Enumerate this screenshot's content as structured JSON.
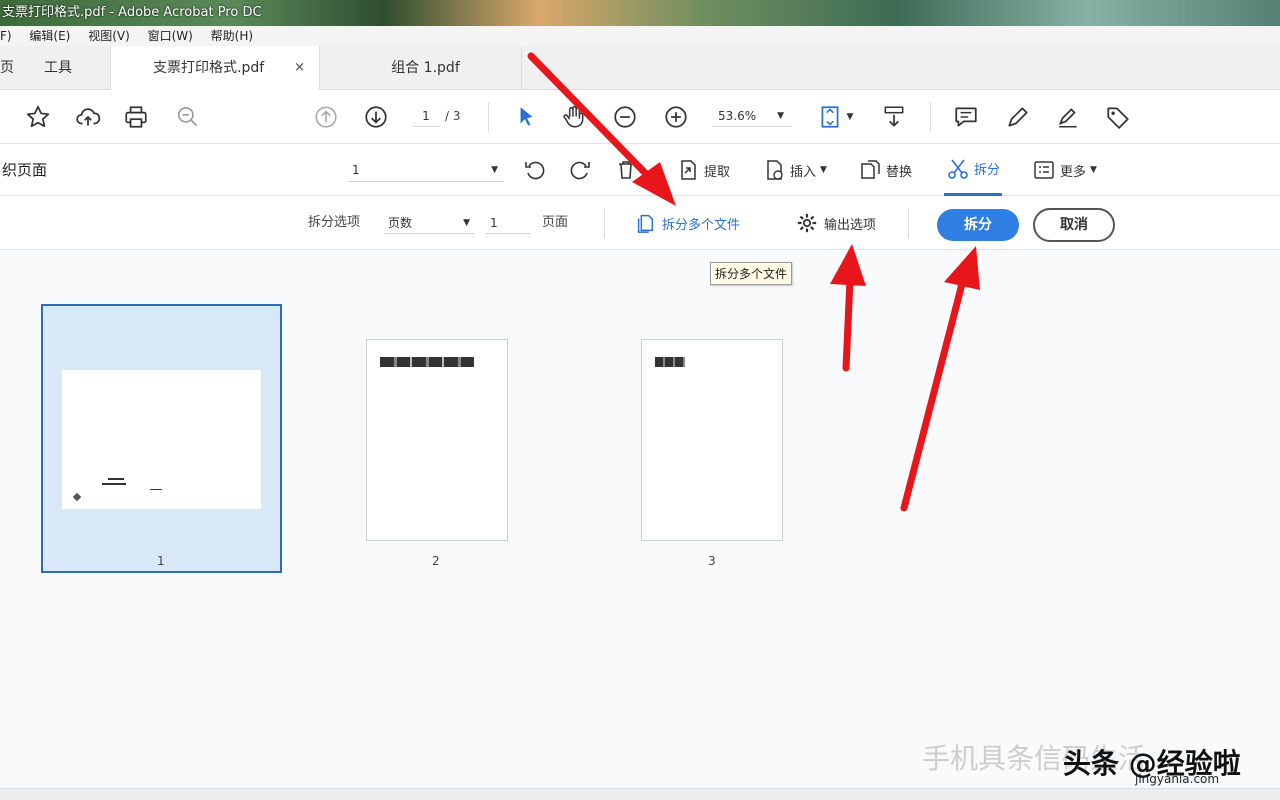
{
  "window": {
    "title": "支票打印格式.pdf - Adobe Acrobat Pro DC"
  },
  "menu": [
    "F)",
    "编辑(E)",
    "视图(V)",
    "窗口(W)",
    "帮助(H)"
  ],
  "tabs": {
    "home": "页",
    "tools": "工具",
    "doc": "支票打印格式.pdf",
    "close": "×",
    "doc2": "组合 1.pdf"
  },
  "toolbar": {
    "page_current": "1",
    "page_total": "/ 3",
    "zoom": "53.6%"
  },
  "organize": {
    "title": "织页面",
    "page_select": "1",
    "items": {
      "extract": "提取",
      "insert": "插入",
      "replace": "替换",
      "split": "拆分",
      "more": "更多"
    }
  },
  "split": {
    "options_label": "拆分选项",
    "mode": "页数",
    "count": "1",
    "unit": "页面",
    "multi_files": "拆分多个文件",
    "output_options": "输出选项",
    "split_button": "拆分",
    "cancel_button": "取消",
    "tooltip": "拆分多个文件"
  },
  "pages": [
    {
      "number": "1"
    },
    {
      "number": "2"
    },
    {
      "number": "3"
    }
  ],
  "watermark": {
    "line1": "手机具条信码生活",
    "line2": "头条 @经验啦",
    "url": "jingyanla.com"
  },
  "colors": {
    "accent": "#2f7ee2",
    "selection": "#d8e8f8",
    "arrow": "#e8161b"
  }
}
